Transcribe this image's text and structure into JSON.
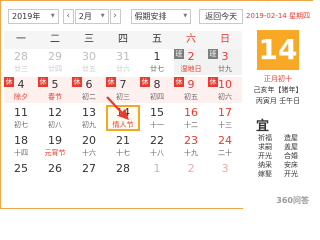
{
  "toolbar": {
    "year": "2019年",
    "month": "2月",
    "holiday": "假期安排",
    "today": "返回今天",
    "prev": "‹",
    "next": "›"
  },
  "weekdays": [
    "一",
    "二",
    "三",
    "四",
    "五",
    "六",
    "日"
  ],
  "weeks": [
    [
      {
        "d": "28",
        "l": "廿三",
        "dim": true
      },
      {
        "d": "29",
        "l": "廿四",
        "dim": true
      },
      {
        "d": "30",
        "l": "廿五",
        "dim": true
      },
      {
        "d": "31",
        "l": "廿六",
        "dim": true
      },
      {
        "d": "1",
        "l": "廿七"
      },
      {
        "d": "2",
        "l": "湿地日",
        "fest": true,
        "we": true,
        "tag": "班"
      },
      {
        "d": "3",
        "l": "廿九",
        "we": true,
        "tag": "班"
      }
    ],
    [
      {
        "d": "4",
        "l": "除夕",
        "fest": true,
        "tag": "休"
      },
      {
        "d": "5",
        "l": "春节",
        "fest": true,
        "tag": "休"
      },
      {
        "d": "6",
        "l": "初二",
        "tag": "休"
      },
      {
        "d": "7",
        "l": "初三",
        "tag": "休"
      },
      {
        "d": "8",
        "l": "初四",
        "tag": "休"
      },
      {
        "d": "9",
        "l": "初五",
        "we": true,
        "tag": "休"
      },
      {
        "d": "10",
        "l": "初六",
        "we": true,
        "tag": "休"
      }
    ],
    [
      {
        "d": "11",
        "l": "初七"
      },
      {
        "d": "12",
        "l": "初八"
      },
      {
        "d": "13",
        "l": "初九"
      },
      {
        "d": "14",
        "l": "情人节",
        "fest": true,
        "sel": true
      },
      {
        "d": "15",
        "l": "十一"
      },
      {
        "d": "16",
        "l": "十二",
        "we": true
      },
      {
        "d": "17",
        "l": "十三",
        "we": true
      }
    ],
    [
      {
        "d": "18",
        "l": "十四"
      },
      {
        "d": "19",
        "l": "元宵节",
        "fest": true
      },
      {
        "d": "20",
        "l": "十六"
      },
      {
        "d": "21",
        "l": "十七"
      },
      {
        "d": "22",
        "l": "十八"
      },
      {
        "d": "23",
        "l": "十九",
        "we": true
      },
      {
        "d": "24",
        "l": "二十",
        "we": true
      }
    ],
    [
      {
        "d": "25",
        "l": ""
      },
      {
        "d": "26",
        "l": ""
      },
      {
        "d": "27",
        "l": ""
      },
      {
        "d": "28",
        "l": ""
      },
      {
        "d": "1",
        "l": "",
        "dim": true
      },
      {
        "d": "2",
        "l": "",
        "dim": true,
        "we": true
      },
      {
        "d": "3",
        "l": "",
        "dim": true,
        "we": true
      }
    ]
  ],
  "side": {
    "date": "2019-02-14 星期四",
    "day": "14",
    "lunar": "正月初十",
    "ganzhi1": "己亥年【猪年】",
    "ganzhi2": "丙寅月 壬午日",
    "yi": "宜",
    "yi_items": [
      "祈福",
      "造屋",
      "求嗣",
      "盖屋",
      "开光",
      "合婚",
      "纳采",
      "安床",
      "嫁娶",
      "开光"
    ]
  },
  "watermark": "360问答",
  "colors": {
    "accent": "#f9a825",
    "red": "#e63b2e"
  }
}
